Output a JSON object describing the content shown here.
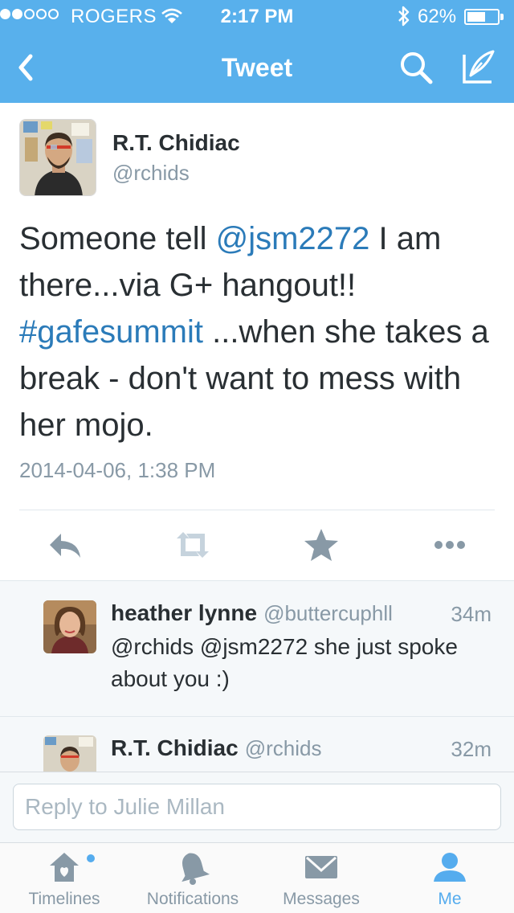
{
  "status_bar": {
    "carrier": "ROGERS",
    "time": "2:17 PM",
    "battery_percent": "62%",
    "battery_level": 0.62,
    "signal_bars": 2
  },
  "nav": {
    "title": "Tweet",
    "back_icon": "chevron-left-icon",
    "search_icon": "search-icon",
    "compose_icon": "compose-icon"
  },
  "tweet": {
    "author_name": "R.T. Chidiac",
    "author_handle": "@rchids",
    "text_parts": {
      "p1": "Someone tell ",
      "mention": "@jsm2272",
      "p2": " I am there...via G+ hangout!! ",
      "hashtag": "#gafesummit",
      "p3": " ...when she takes a break - don't want to mess with her mojo."
    },
    "timestamp": "2014-04-06, 1:38 PM",
    "actions": [
      "reply-icon",
      "retweet-icon",
      "favorite-icon",
      "more-icon"
    ]
  },
  "replies": [
    {
      "name": "heather lynne",
      "handle": "@buttercuphll",
      "time": "34m",
      "text": "@rchids @jsm2272 she just spoke about you :)"
    },
    {
      "name": "R.T. Chidiac",
      "handle": "@rchids",
      "time": "32m",
      "text": ""
    }
  ],
  "reply_box": {
    "placeholder": "Reply to Julie Millan"
  },
  "tabs": [
    {
      "label": "Timelines",
      "icon": "home-icon"
    },
    {
      "label": "Notifications",
      "icon": "bell-icon"
    },
    {
      "label": "Messages",
      "icon": "envelope-icon"
    },
    {
      "label": "Me",
      "icon": "person-icon"
    }
  ],
  "colors": {
    "brand": "#58b0ec",
    "link": "#2b7bb9",
    "muted": "#8899a6",
    "text": "#292f33",
    "active_tab": "#55acee"
  }
}
